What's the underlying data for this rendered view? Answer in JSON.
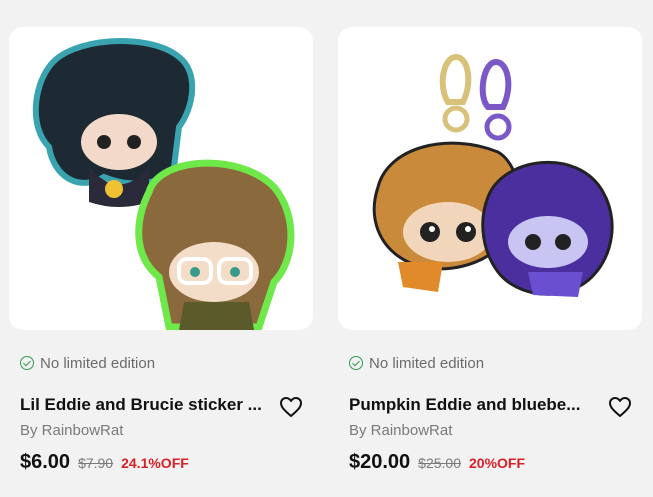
{
  "products": [
    {
      "badge": "No limited edition",
      "title": "Lil Eddie and Brucie sticker ...",
      "seller": "By RainbowRat",
      "price": "$6.00",
      "old_price": "$7.90",
      "discount": "24.1%OFF",
      "image_icon": "sticker-image"
    },
    {
      "badge": "No limited edition",
      "title": "Pumpkin Eddie and bluebe...",
      "seller": "By RainbowRat",
      "price": "$20.00",
      "old_price": "$25.00",
      "discount": "20%OFF",
      "image_icon": "keychain-image"
    }
  ],
  "colors": {
    "discount": "#d81f26",
    "check": "#2e9c4f",
    "background": "#f2f2f2"
  }
}
